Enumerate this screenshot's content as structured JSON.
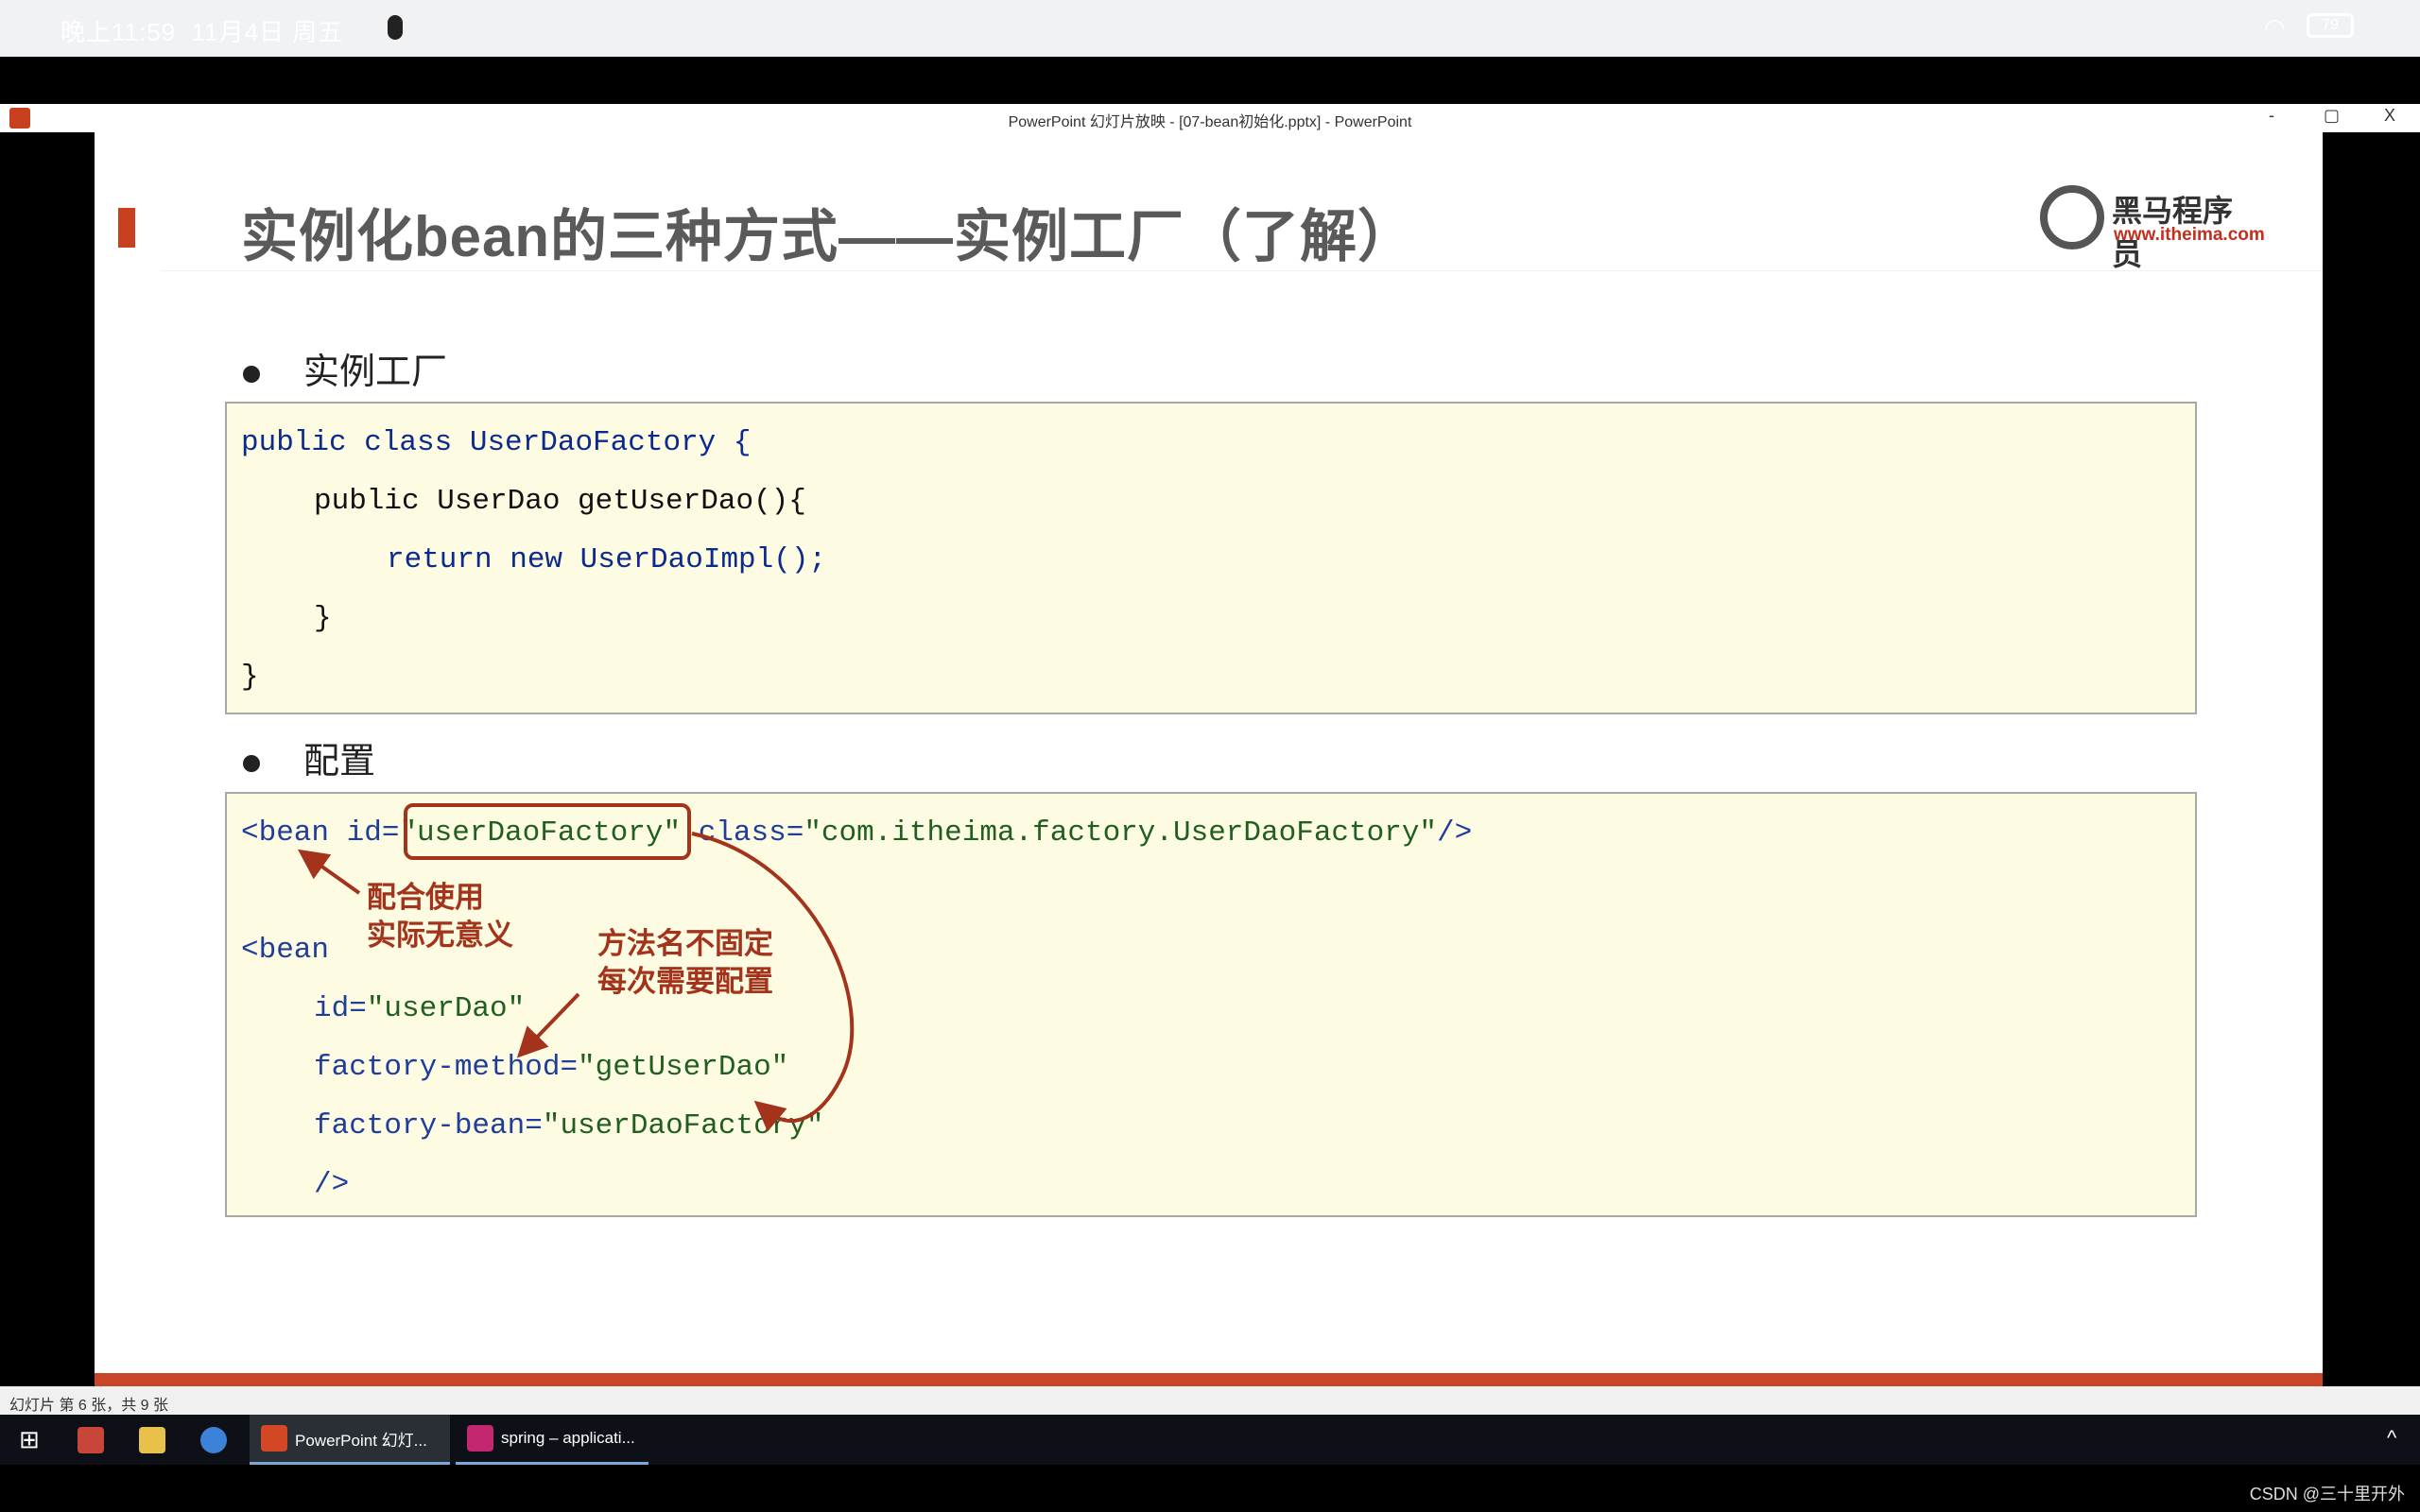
{
  "statusbar": {
    "time": "晚上11:59",
    "date": "11月4日 周五",
    "battery": "79"
  },
  "window": {
    "title": "PowerPoint 幻灯片放映 - [07-bean初始化.pptx] - PowerPoint",
    "minimize": "-",
    "restore": "▢",
    "close": "X"
  },
  "slide": {
    "title": "实例化bean的三种方式——实例工厂（了解）",
    "logo": {
      "name": "黑马程序员",
      "url": "www.itheima.com"
    },
    "bullets": [
      "实例工厂",
      "配置"
    ],
    "code1": [
      "public class UserDaoFactory {",
      "public UserDao getUserDao(){",
      "return new UserDaoImpl();",
      "}",
      "}"
    ],
    "code2": {
      "l1a": "<bean id=",
      "l1b": "\"userDaoFactory\"",
      "l1c": " class=",
      "l1d": "\"com.itheima.factory.UserDaoFactory\"",
      "l1e": "/>",
      "l2": "<bean",
      "l3a": "id=",
      "l3b": "\"userDao\"",
      "l4a": "factory-method=",
      "l4b": "\"getUserDao\"",
      "l5a": "factory-bean=",
      "l5b": "\"userDaoFactory\"",
      "l6": "/>"
    },
    "notes": {
      "n1a": "配合使用",
      "n1b": "实际无意义",
      "n2a": "方法名不固定",
      "n2b": "每次需要配置"
    },
    "annotation_color": "#a3331b"
  },
  "ppt_status": "幻灯片 第 6 张，共 9 张",
  "taskbar": {
    "items": [
      "PowerPoint 幻灯...",
      "spring – applicati..."
    ]
  },
  "watermark": "CSDN @三十里开外"
}
